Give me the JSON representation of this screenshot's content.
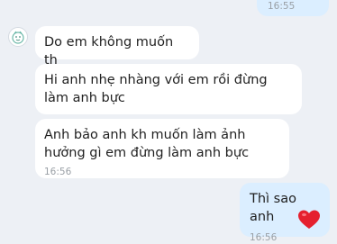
{
  "conversation": {
    "top_outgoing": {
      "time": "16:55"
    },
    "messages": [
      {
        "direction": "in",
        "text": "Do em không muốn th"
      },
      {
        "direction": "in",
        "text": "Hi anh nhẹ nhàng với em rồi đừng làm anh bực"
      },
      {
        "direction": "in",
        "text": "Anh bảo anh kh muốn làm ảnh hưởng gì em đừng làm anh bực",
        "time": "16:56"
      },
      {
        "direction": "out",
        "text": "Thì sao anh",
        "time": "16:56",
        "reaction": "heart-reaction"
      }
    ]
  },
  "colors": {
    "background": "#edf0f5",
    "incoming_bubble": "#ffffff",
    "outgoing_bubble": "#dbeeff",
    "reaction_heart": "#e5202e"
  }
}
